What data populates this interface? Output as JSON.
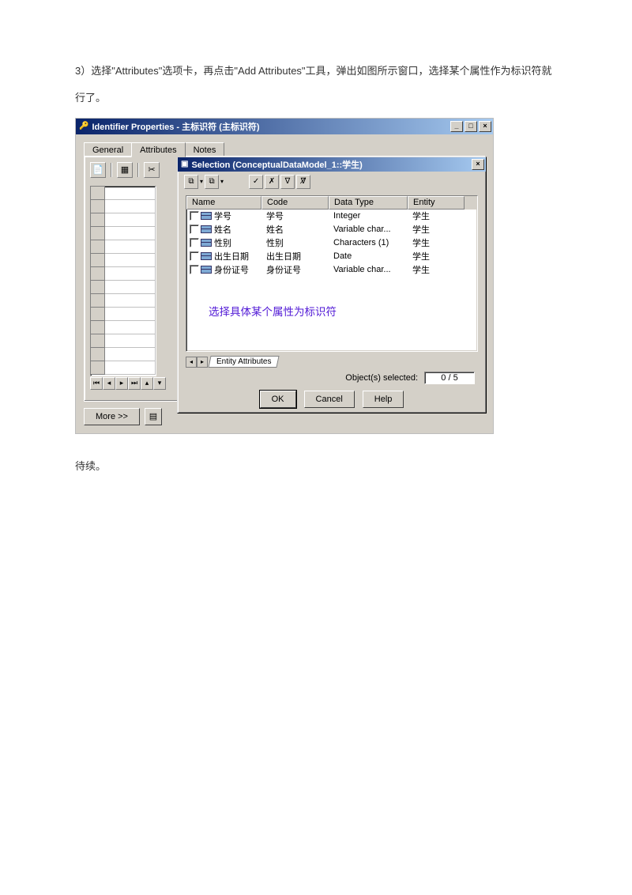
{
  "paragraph": "3）选择\"Attributes\"选项卡，再点击\"Add Attributes\"工具，弹出如图所示窗口，选择某个属性作为标识符就行了。",
  "tobecontinued": "待续。",
  "outer": {
    "title": "Identifier Properties - 主标识符 (主标识符)",
    "tabs": {
      "general": "General",
      "attributes": "Attributes",
      "notes": "Notes"
    },
    "more": "More >>"
  },
  "dialog": {
    "title": "Selection (ConceptualDataModel_1::学生)",
    "columns": {
      "name": "Name",
      "code": "Code",
      "dtype": "Data Type",
      "entity": "Entity"
    },
    "rows": [
      {
        "name": "学号",
        "code": "学号",
        "dtype": "Integer",
        "entity": "学生"
      },
      {
        "name": "姓名",
        "code": "姓名",
        "dtype": "Variable char...",
        "entity": "学生"
      },
      {
        "name": "性别",
        "code": "性别",
        "dtype": "Characters (1)",
        "entity": "学生"
      },
      {
        "name": "出生日期",
        "code": "出生日期",
        "dtype": "Date",
        "entity": "学生"
      },
      {
        "name": "身份证号",
        "code": "身份证号",
        "dtype": "Variable char...",
        "entity": "学生"
      }
    ],
    "annotation": "选择具体某个属性为标识符",
    "tabstrip": "Entity Attributes",
    "status_label": "Object(s) selected:",
    "status_value": "0 / 5",
    "ok": "OK",
    "cancel": "Cancel",
    "help": "Help"
  }
}
